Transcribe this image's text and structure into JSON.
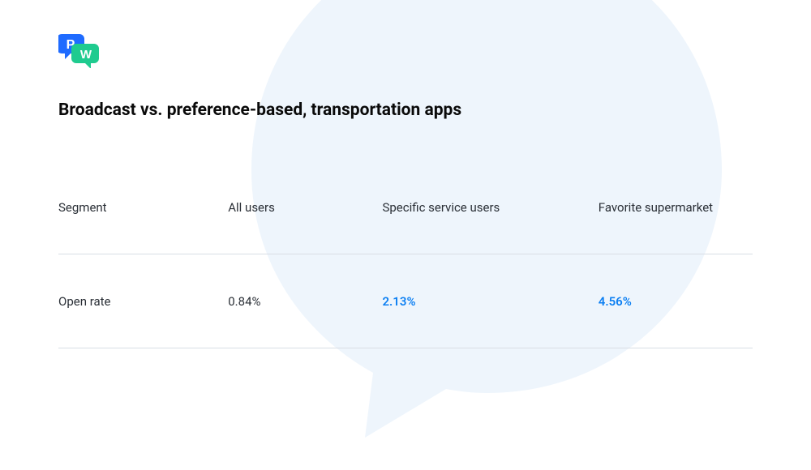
{
  "title": "Broadcast vs. preference-based, transportation apps",
  "table": {
    "row_label_header": "Segment",
    "row_label_data": "Open rate",
    "columns": [
      {
        "header": "All users",
        "value": "0.84%",
        "accent": false
      },
      {
        "header": "Specific service users",
        "value": "2.13%",
        "accent": true
      },
      {
        "header": "Favorite supermarket",
        "value": "4.56%",
        "accent": true
      }
    ]
  },
  "chart_data": {
    "type": "table",
    "title": "Broadcast vs. preference-based, transportation apps",
    "xlabel": "Segment",
    "ylabel": "Open rate",
    "categories": [
      "All users",
      "Specific service users",
      "Favorite supermarket"
    ],
    "values": [
      0.84,
      2.13,
      4.56
    ],
    "unit": "%"
  }
}
